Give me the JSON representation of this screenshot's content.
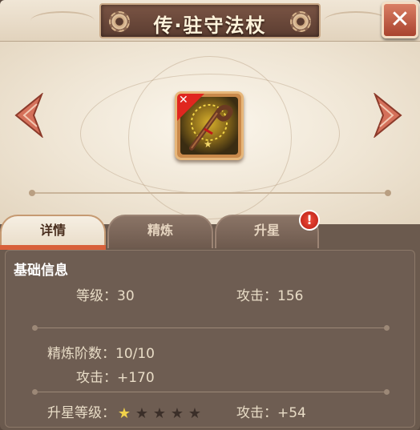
{
  "title": "传·驻守法杖",
  "close_label": "✕",
  "tabs": [
    {
      "label": "详情",
      "active": true
    },
    {
      "label": "精炼",
      "active": false
    },
    {
      "label": "升星",
      "active": false,
      "alert": "!"
    }
  ],
  "item": {
    "corner_icon": "crossed-swords-icon",
    "stars": 1
  },
  "info": {
    "section_title": "基础信息",
    "level_label": "等级：",
    "level_value": "30",
    "attack_label": "攻击：",
    "attack_value": "156",
    "refine_stage_label": "精炼阶数：",
    "refine_stage_value": "10/10",
    "refine_attack_label": "攻击：",
    "refine_attack_value": "+170",
    "star_level_label": "升星等级：",
    "star_level_total": 5,
    "star_level_filled": 1,
    "star_attack_label": "攻击：",
    "star_attack_value": "+54"
  },
  "colors": {
    "panel": "#6b5a4e",
    "title_plate": "#6a4839",
    "accent_tab": "#d8603a",
    "alert": "#d9261b",
    "star_on": "#f1d24a"
  }
}
